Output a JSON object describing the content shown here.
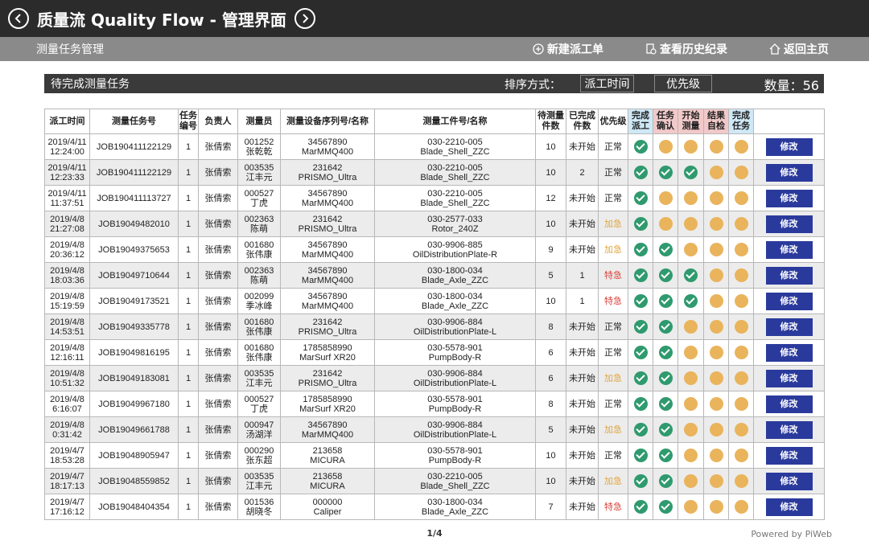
{
  "app": {
    "title": "质量流 Quality Flow - 管理界面",
    "subtitle": "测量任务管理",
    "actions": [
      "新建派工单",
      "查看历史纪录",
      "返回主页"
    ]
  },
  "taskbar": {
    "title": "待完成测量任务",
    "sort_label": "排序方式：",
    "sort_options": [
      "派工时间",
      "优先级"
    ],
    "count_label": "数量：56"
  },
  "table": {
    "headers": [
      "派工时间",
      "测量任务号",
      "任务编号",
      "负责人",
      "测量员",
      "测量设备序列号/名称",
      "测量工件号/名称",
      "待测量件数",
      "已完成件数",
      "优先级",
      "完成派工",
      "任务确认",
      "开始测量",
      "结果自检",
      "完成任务",
      ""
    ],
    "edit_label": "修改",
    "rows": [
      {
        "date": "2019/4/11",
        "time": "12:24:00",
        "job": "JOB190411122129",
        "no": "1",
        "owner": "张倩索",
        "mid": "001252",
        "mname": "张乾乾",
        "dev": "34567890",
        "devname": "MarMMQ400",
        "part": "030-2210-005",
        "partname": "Blade_Shell_ZZC",
        "todo": "10",
        "done": "未开始",
        "prio": "正常",
        "status": [
          "ok",
          "wait",
          "wait",
          "wait",
          "wait"
        ]
      },
      {
        "date": "2019/4/11",
        "time": "12:23:33",
        "job": "JOB190411122129",
        "no": "1",
        "owner": "张倩索",
        "mid": "003535",
        "mname": "江丰元",
        "dev": "231642",
        "devname": "PRISMO_Ultra",
        "part": "030-2210-005",
        "partname": "Blade_Shell_ZZC",
        "todo": "10",
        "done": "2",
        "prio": "正常",
        "status": [
          "ok",
          "ok",
          "ok",
          "wait",
          "wait"
        ]
      },
      {
        "date": "2019/4/11",
        "time": "11:37:51",
        "job": "JOB190411113727",
        "no": "1",
        "owner": "张倩索",
        "mid": "000527",
        "mname": "丁虎",
        "dev": "34567890",
        "devname": "MarMMQ400",
        "part": "030-2210-005",
        "partname": "Blade_Shell_ZZC",
        "todo": "12",
        "done": "未开始",
        "prio": "正常",
        "status": [
          "ok",
          "wait",
          "wait",
          "wait",
          "wait"
        ]
      },
      {
        "date": "2019/4/8",
        "time": "21:27:08",
        "job": "JOB19049482010",
        "no": "1",
        "owner": "张倩索",
        "mid": "002363",
        "mname": "陈萌",
        "dev": "231642",
        "devname": "PRISMO_Ultra",
        "part": "030-2577-033",
        "partname": "Rotor_240Z",
        "todo": "10",
        "done": "未开始",
        "prio": "加急",
        "status": [
          "ok",
          "wait",
          "wait",
          "wait",
          "wait"
        ]
      },
      {
        "date": "2019/4/8",
        "time": "20:36:12",
        "job": "JOB19049375653",
        "no": "1",
        "owner": "张倩索",
        "mid": "001680",
        "mname": "张伟康",
        "dev": "34567890",
        "devname": "MarMMQ400",
        "part": "030-9906-885",
        "partname": "OilDistributionPlate-R",
        "todo": "9",
        "done": "未开始",
        "prio": "加急",
        "status": [
          "ok",
          "ok",
          "wait",
          "wait",
          "wait"
        ]
      },
      {
        "date": "2019/4/8",
        "time": "18:03:36",
        "job": "JOB19049710644",
        "no": "1",
        "owner": "张倩索",
        "mid": "002363",
        "mname": "陈萌",
        "dev": "34567890",
        "devname": "MarMMQ400",
        "part": "030-1800-034",
        "partname": "Blade_Axle_ZZC",
        "todo": "5",
        "done": "1",
        "prio": "特急",
        "status": [
          "ok",
          "ok",
          "ok",
          "wait",
          "wait"
        ]
      },
      {
        "date": "2019/4/8",
        "time": "15:19:59",
        "job": "JOB19049173521",
        "no": "1",
        "owner": "张倩索",
        "mid": "002099",
        "mname": "季冰峰",
        "dev": "34567890",
        "devname": "MarMMQ400",
        "part": "030-1800-034",
        "partname": "Blade_Axle_ZZC",
        "todo": "10",
        "done": "1",
        "prio": "特急",
        "status": [
          "ok",
          "ok",
          "ok",
          "wait",
          "wait"
        ]
      },
      {
        "date": "2019/4/8",
        "time": "14:53:51",
        "job": "JOB19049335778",
        "no": "1",
        "owner": "张倩索",
        "mid": "001680",
        "mname": "张伟康",
        "dev": "231642",
        "devname": "PRISMO_Ultra",
        "part": "030-9906-884",
        "partname": "OilDistributionPlate-L",
        "todo": "8",
        "done": "未开始",
        "prio": "正常",
        "status": [
          "ok",
          "ok",
          "wait",
          "wait",
          "wait"
        ]
      },
      {
        "date": "2019/4/8",
        "time": "12:16:11",
        "job": "JOB19049816195",
        "no": "1",
        "owner": "张倩索",
        "mid": "001680",
        "mname": "张伟康",
        "dev": "1785858990",
        "devname": "MarSurf XR20",
        "part": "030-5578-901",
        "partname": "PumpBody-R",
        "todo": "6",
        "done": "未开始",
        "prio": "正常",
        "status": [
          "ok",
          "ok",
          "wait",
          "wait",
          "wait"
        ]
      },
      {
        "date": "2019/4/8",
        "time": "10:51:32",
        "job": "JOB19049183081",
        "no": "1",
        "owner": "张倩索",
        "mid": "003535",
        "mname": "江丰元",
        "dev": "231642",
        "devname": "PRISMO_Ultra",
        "part": "030-9906-884",
        "partname": "OilDistributionPlate-L",
        "todo": "6",
        "done": "未开始",
        "prio": "加急",
        "status": [
          "ok",
          "ok",
          "wait",
          "wait",
          "wait"
        ]
      },
      {
        "date": "2019/4/8",
        "time": "6:16:07",
        "job": "JOB19049967180",
        "no": "1",
        "owner": "张倩索",
        "mid": "000527",
        "mname": "丁虎",
        "dev": "1785858990",
        "devname": "MarSurf XR20",
        "part": "030-5578-901",
        "partname": "PumpBody-R",
        "todo": "8",
        "done": "未开始",
        "prio": "正常",
        "status": [
          "ok",
          "ok",
          "wait",
          "wait",
          "wait"
        ]
      },
      {
        "date": "2019/4/8",
        "time": "0:31:42",
        "job": "JOB19049661788",
        "no": "1",
        "owner": "张倩索",
        "mid": "000947",
        "mname": "汤湖洋",
        "dev": "34567890",
        "devname": "MarMMQ400",
        "part": "030-9906-884",
        "partname": "OilDistributionPlate-L",
        "todo": "5",
        "done": "未开始",
        "prio": "加急",
        "status": [
          "ok",
          "ok",
          "wait",
          "wait",
          "wait"
        ]
      },
      {
        "date": "2019/4/7",
        "time": "18:53:28",
        "job": "JOB19048905947",
        "no": "1",
        "owner": "张倩索",
        "mid": "000290",
        "mname": "张东超",
        "dev": "213658",
        "devname": "MICURA",
        "part": "030-5578-901",
        "partname": "PumpBody-R",
        "todo": "10",
        "done": "未开始",
        "prio": "正常",
        "status": [
          "ok",
          "ok",
          "wait",
          "wait",
          "wait"
        ]
      },
      {
        "date": "2019/4/7",
        "time": "18:17:13",
        "job": "JOB19048559852",
        "no": "1",
        "owner": "张倩索",
        "mid": "003535",
        "mname": "江丰元",
        "dev": "213658",
        "devname": "MICURA",
        "part": "030-2210-005",
        "partname": "Blade_Shell_ZZC",
        "todo": "10",
        "done": "未开始",
        "prio": "加急",
        "status": [
          "ok",
          "ok",
          "wait",
          "wait",
          "wait"
        ]
      },
      {
        "date": "2019/4/7",
        "time": "17:16:12",
        "job": "JOB19048404354",
        "no": "1",
        "owner": "张倩索",
        "mid": "001536",
        "mname": "胡晓冬",
        "dev": "000000",
        "devname": "Caliper",
        "part": "030-1800-034",
        "partname": "Blade_Axle_ZZC",
        "todo": "7",
        "done": "未开始",
        "prio": "特急",
        "status": [
          "ok",
          "ok",
          "wait",
          "wait",
          "wait"
        ]
      }
    ]
  },
  "footer": {
    "page": "1/4",
    "powered": "Powered by PiWeb"
  }
}
